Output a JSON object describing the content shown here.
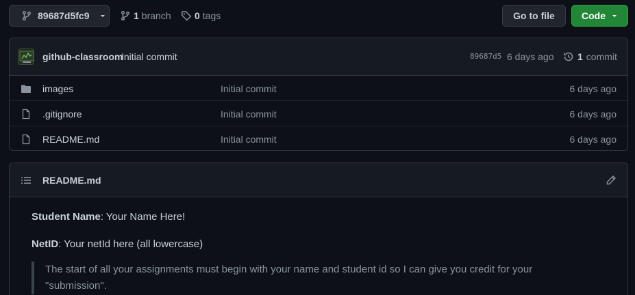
{
  "toolbar": {
    "branch_name": "89687d5fc9",
    "branch_count": "1",
    "branch_label": "branch",
    "tag_count": "0",
    "tag_label": "tags",
    "goto_file_label": "Go to file",
    "code_label": "Code"
  },
  "latest_commit": {
    "author": "github-classroom",
    "message": "Initial commit",
    "sha": "89687d5",
    "age": "6 days ago",
    "commit_count": "1",
    "commit_label": "commit"
  },
  "files": [
    {
      "name": "images",
      "type": "folder",
      "commit": "Initial commit",
      "age": "6 days ago"
    },
    {
      "name": ".gitignore",
      "type": "file",
      "commit": "Initial commit",
      "age": "6 days ago"
    },
    {
      "name": "README.md",
      "type": "file",
      "commit": "Initial commit",
      "age": "6 days ago"
    }
  ],
  "readme": {
    "title": "README.md",
    "student_name_label": "Student Name",
    "student_name_value": ": Your Name Here!",
    "netid_label": "NetID",
    "netid_value": ": Your netId here (all lowercase)",
    "quote": "The start of all your assignments must begin with your name and student id so I can give you credit for your \"submission\"."
  },
  "colors": {
    "background": "#0d1117",
    "header": "#161b22",
    "border": "#30363d",
    "code_button": "#238636",
    "muted_text": "#8b949e"
  }
}
